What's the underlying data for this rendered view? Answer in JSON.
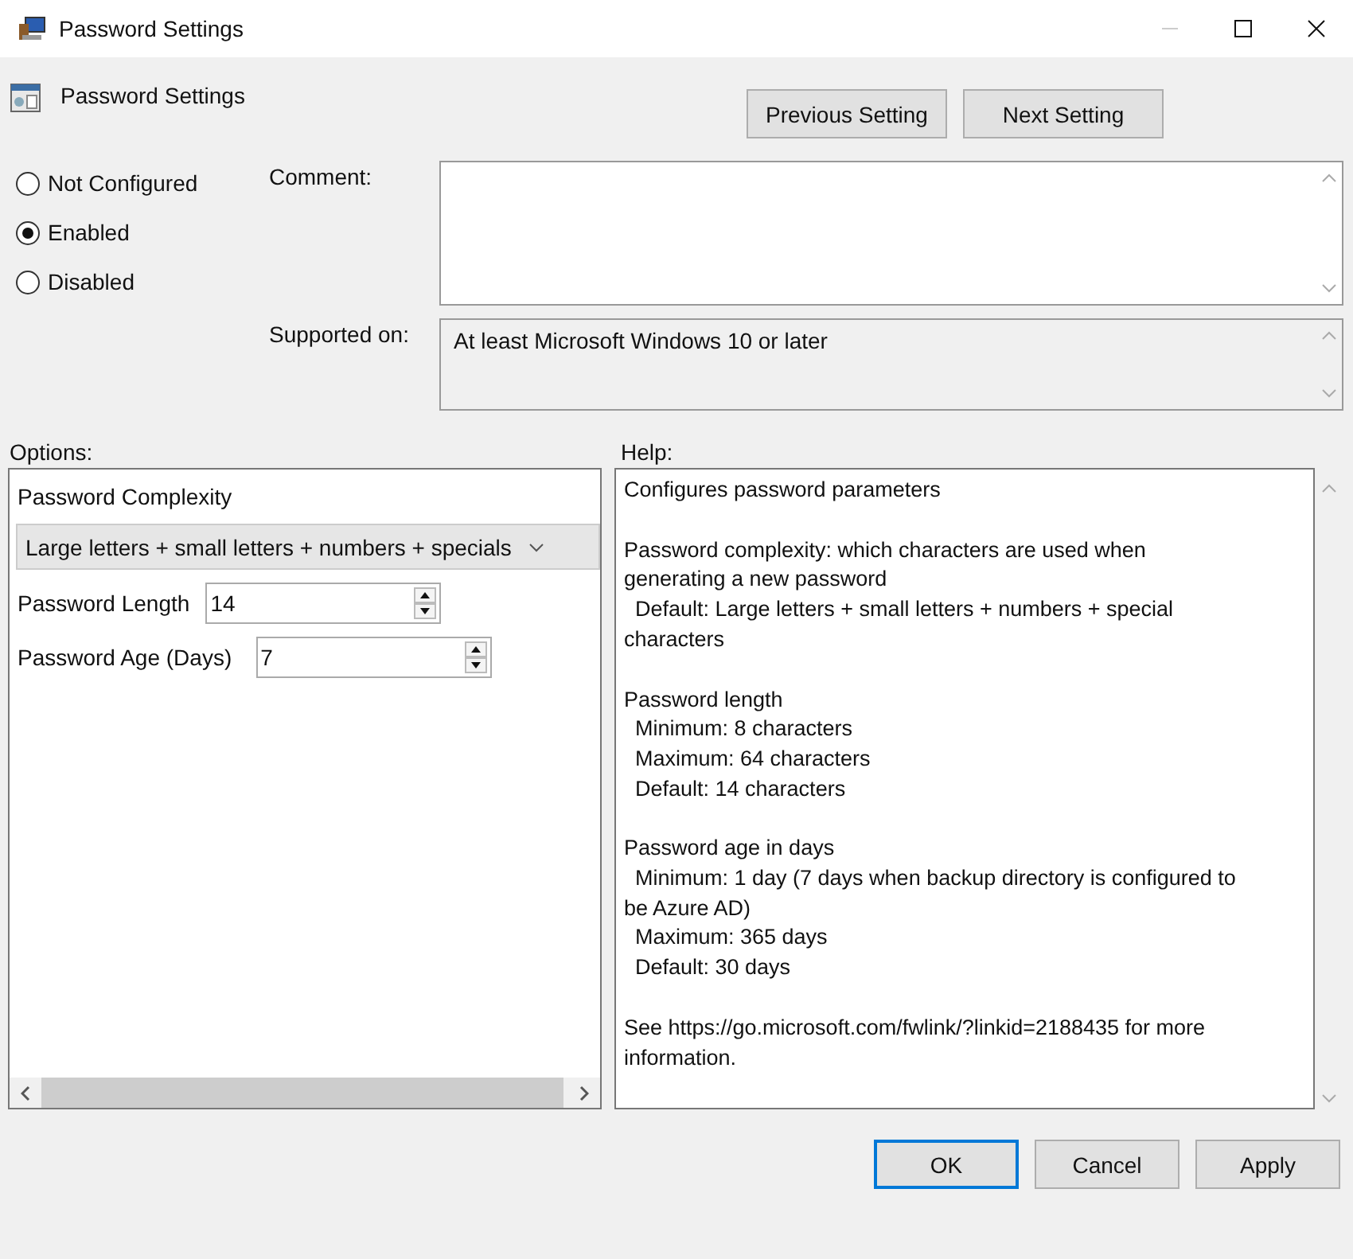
{
  "window": {
    "title": "Password Settings"
  },
  "header": {
    "title": "Password Settings",
    "buttons": [
      "Previous Setting",
      "Next Setting"
    ]
  },
  "state_options": [
    {
      "label": "Not Configured",
      "selected": false
    },
    {
      "label": "Enabled",
      "selected": true
    },
    {
      "label": "Disabled",
      "selected": false
    }
  ],
  "comment": {
    "label": "Comment:"
  },
  "supported_on": {
    "label": "Supported on:",
    "value": "At least Microsoft Windows 10 or later"
  },
  "options": {
    "label": "Options:",
    "complexity_label": "Password Complexity",
    "complexity_value": "Large letters + small letters + numbers + specials",
    "fields": [
      {
        "label": "Password Length",
        "value": "14"
      },
      {
        "label": "Password Age (Days)",
        "value": "7"
      }
    ]
  },
  "help": {
    "label": "Help:",
    "paragraphs": [
      [
        {
          "text": "Configures password parameters",
          "indent": false
        }
      ],
      [
        {
          "text": "Password complexity: which characters are used when",
          "indent": false
        },
        {
          "text": "generating a new password",
          "indent": false
        },
        {
          "text": "Default: Large letters + small letters + numbers + special",
          "indent": true
        },
        {
          "text": "characters",
          "indent": false
        }
      ],
      [
        {
          "text": "Password length",
          "indent": false
        },
        {
          "text": "Minimum: 8 characters",
          "indent": true
        },
        {
          "text": "Maximum: 64 characters",
          "indent": true
        },
        {
          "text": "Default: 14 characters",
          "indent": true
        }
      ],
      [
        {
          "text": "Password age in days",
          "indent": false
        },
        {
          "text": "Minimum: 1 day (7 days when backup directory is configured to",
          "indent": true
        },
        {
          "text": "be Azure AD)",
          "indent": false
        },
        {
          "text": "Maximum: 365 days",
          "indent": true
        },
        {
          "text": "Default: 30 days",
          "indent": true
        }
      ],
      [
        {
          "text": "See https://go.microsoft.com/fwlink/?linkid=2188435 for more",
          "indent": false
        },
        {
          "text": "information.",
          "indent": false
        }
      ]
    ]
  },
  "footer_buttons": [
    {
      "label": "OK",
      "default": true
    },
    {
      "label": "Cancel",
      "default": false
    },
    {
      "label": "Apply",
      "default": false
    }
  ]
}
